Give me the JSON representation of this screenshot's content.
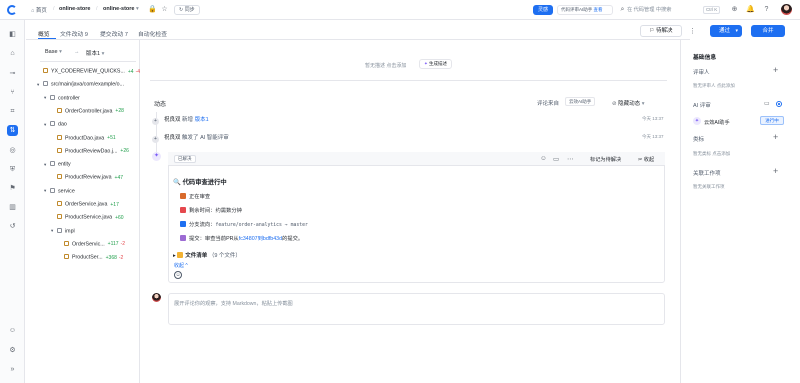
{
  "header": {
    "breadcrumb": [
      "首页",
      "online-store",
      "online-store"
    ],
    "separator": "/",
    "sync_label": "同步",
    "ai_badge": "灵感",
    "ai_promo_text": "代码评审AI助手",
    "ai_promo_link": "查看",
    "search_placeholder": "在 代码管理 中搜索",
    "search_shortcut": "Ctrl K"
  },
  "tabs": [
    {
      "label": "概览",
      "active": true
    },
    {
      "label": "文件改动 9"
    },
    {
      "label": "提交改动 7"
    },
    {
      "label": "自动化检查"
    }
  ],
  "actions": {
    "pending_label": "待解决",
    "pass_label": "通过",
    "merge_label": "合并"
  },
  "file_tree": {
    "base_label": "Base",
    "arrow": "→",
    "version_label": "版本1",
    "rows": [
      {
        "name": "YX_CODEREVIEW_QUICKS...",
        "add": "+4",
        "del": "-4",
        "indent": 0,
        "type": "file",
        "caret": ""
      },
      {
        "name": "src/main/java/com/example/o...",
        "indent": 0,
        "type": "folder",
        "caret": "▾"
      },
      {
        "name": "controller",
        "indent": 1,
        "type": "folder",
        "caret": "▾"
      },
      {
        "name": "OrderController.java",
        "add": "+28",
        "indent": 2,
        "type": "file",
        "caret": ""
      },
      {
        "name": "dao",
        "indent": 1,
        "type": "folder",
        "caret": "▾"
      },
      {
        "name": "ProductDao.java",
        "add": "+51",
        "indent": 2,
        "type": "file",
        "caret": ""
      },
      {
        "name": "ProductReviewDao.j...",
        "add": "+26",
        "indent": 2,
        "type": "file",
        "caret": ""
      },
      {
        "name": "entity",
        "indent": 1,
        "type": "folder",
        "caret": "▾"
      },
      {
        "name": "ProductReview.java",
        "add": "+47",
        "indent": 2,
        "type": "file",
        "caret": ""
      },
      {
        "name": "service",
        "indent": 1,
        "type": "folder",
        "caret": "▾"
      },
      {
        "name": "OrderService.java",
        "add": "+17",
        "indent": 2,
        "type": "file",
        "caret": ""
      },
      {
        "name": "ProductService.java",
        "add": "+60",
        "indent": 2,
        "type": "file",
        "caret": ""
      },
      {
        "name": "impl",
        "indent": 2,
        "type": "folder",
        "caret": "▾"
      },
      {
        "name": "OrderServic...",
        "add": "+117",
        "del": "-2",
        "indent": 3,
        "type": "file",
        "caret": ""
      },
      {
        "name": "ProductSer...",
        "add": "+368",
        "del": "-2",
        "indent": 3,
        "type": "file",
        "caret": ""
      }
    ]
  },
  "description": {
    "empty_text": "暂无描述 点击添加",
    "generate_label": "生成描述",
    "spark_icon": "✦"
  },
  "activity": {
    "title": "动态",
    "filter_label": "评论来自",
    "filter_tag": "云效AI助手",
    "hide_label": "隐藏动态",
    "events": [
      {
        "user": "祝良双",
        "action": "新增",
        "target": "版本1",
        "time": "今天 13:37",
        "icon": "+"
      },
      {
        "user": "祝良双",
        "action": "触发了 AI 智能评审",
        "target": "",
        "time": "今天 13:37",
        "icon": "+"
      }
    ]
  },
  "review_card": {
    "status_chip": "已解决",
    "mark_pending": "标记为待解决",
    "collapse_label": "收起",
    "title": "代码审查进行中",
    "lines": [
      {
        "icon": "⏳",
        "text": "正在审查",
        "color": "#d86a2b"
      },
      {
        "icon": "⏰",
        "text": "剩余时间：约需数分钟",
        "color": "#e5484d"
      },
      {
        "icon": "⇄",
        "text_prefix": "分支流向：",
        "mono": "feature/order-analytics → master",
        "color": "#1e6ff1"
      },
      {
        "icon": "⚙",
        "text_prefix": "提交：审查当前PR从",
        "link": "fc34807到bdfb43d",
        "text_suffix": "的提交。",
        "color": "#9c6bd3"
      }
    ],
    "files_label": "文件清单",
    "files_count": "（9 个文件）",
    "collapse_link": "收起 ^"
  },
  "comment": {
    "placeholder": "展开评论你的观察，支持 Markdown，粘贴上传截图"
  },
  "right_panel": {
    "section_title": "基础信息",
    "reviewer_label": "评审人",
    "reviewer_sub": "暂无评审人 点此添加",
    "ai_review_label": "AI 评审",
    "ai_bot_name": "云效AI助手",
    "ai_status": "进行中",
    "tag_label": "类标",
    "tag_sub": "暂无类标 点击添加",
    "workitem_label": "关联工作项",
    "workitem_sub": "暂无关联工作项"
  },
  "colors": {
    "accent": "#1e6ff1",
    "add": "#1f9e4a",
    "delete": "#e5484d"
  }
}
